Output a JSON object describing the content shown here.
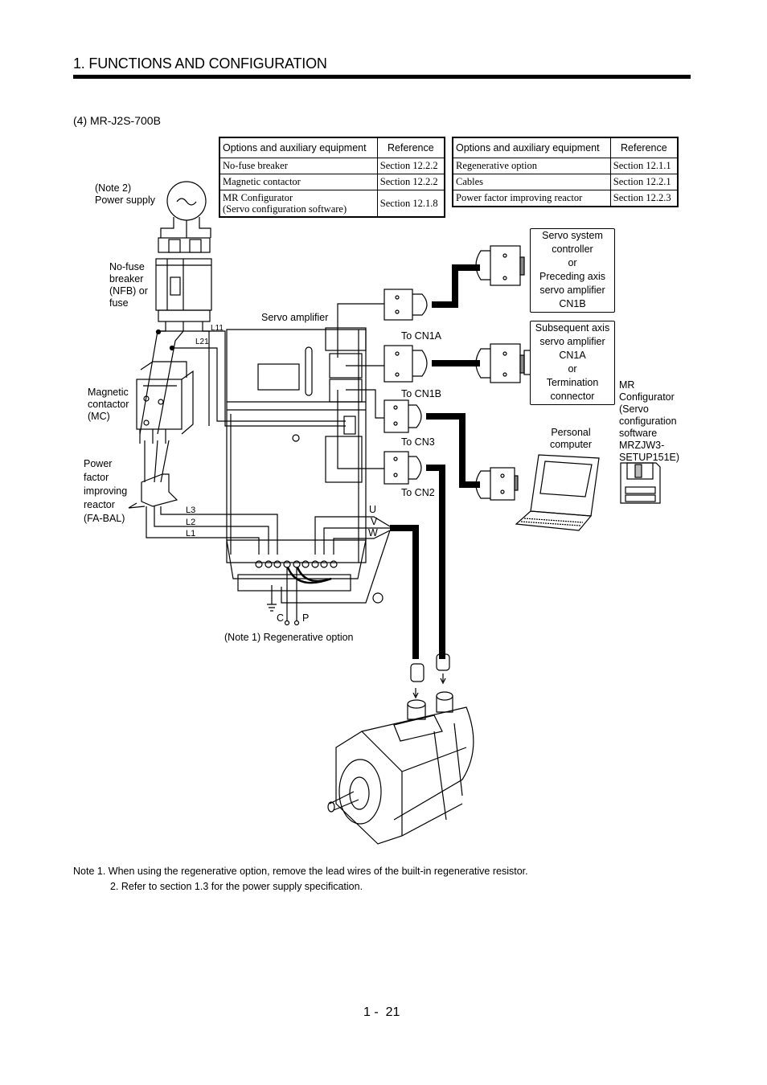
{
  "page": {
    "header_title": "1. FUNCTIONS AND CONFIGURATION",
    "section_title": "(4) MR-J2S-700B",
    "page_number": "1 -  21"
  },
  "tables": [
    {
      "headers": [
        "Options and auxiliary equipment",
        "Reference"
      ],
      "rows": [
        {
          "item": "No-fuse breaker",
          "ref": "Section 12.2.2"
        },
        {
          "item": "Magnetic contactor",
          "ref": "Section 12.2.2"
        },
        {
          "item": "MR Configurator",
          "item2": "(Servo configuration software)",
          "ref": "Section 12.1.8"
        }
      ]
    },
    {
      "headers": [
        "Options and auxiliary equipment",
        "Reference"
      ],
      "rows": [
        {
          "item": "Regenerative option",
          "ref": "Section 12.1.1"
        },
        {
          "item": "Cables",
          "ref": "Section 12.2.1"
        },
        {
          "item": "Power factor improving reactor",
          "ref": "Section 12.2.3"
        }
      ]
    }
  ],
  "labels": {
    "power_supply": [
      "(Note 2)",
      "Power supply"
    ],
    "nfb": [
      "No-fuse",
      "breaker",
      "(NFB) or",
      "fuse"
    ],
    "mc": [
      "Magnetic",
      "contactor",
      "(MC)"
    ],
    "reactor": [
      "Power",
      "factor",
      "improving",
      "reactor",
      "(FA-BAL)"
    ],
    "servo_amplifier": "Servo amplifier",
    "l11": "L11",
    "l21": "L21",
    "l3": "L3",
    "l2": "L2",
    "l1": "L1",
    "u": "U",
    "v": "V",
    "w": "W",
    "c": "C",
    "p": "P",
    "regen_option": "(Note 1) Regenerative option",
    "to_cn1a": "To CN1A",
    "to_cn1b": "To CN1B",
    "to_cn3": "To CN3",
    "to_cn2": "To CN2",
    "personal_computer": [
      "Personal",
      "computer"
    ],
    "mr_configurator": [
      "MR",
      "Configurator",
      "(Servo",
      "configuration",
      "software",
      "MRZJW3-",
      "SETUP151E)"
    ]
  },
  "boxes": {
    "controller": [
      "Servo system",
      "controller",
      "or",
      "Preceding axis",
      "servo amplifier",
      "CN1B"
    ],
    "subsequent": [
      "Subsequent axis",
      "servo amplifier",
      "CN1A",
      "or",
      "Termination",
      "connector"
    ]
  },
  "notes": [
    "Note 1. When using the regenerative option, remove the lead wires of the built-in regenerative resistor.",
    "2. Refer to section 1.3 for the power supply specification."
  ]
}
